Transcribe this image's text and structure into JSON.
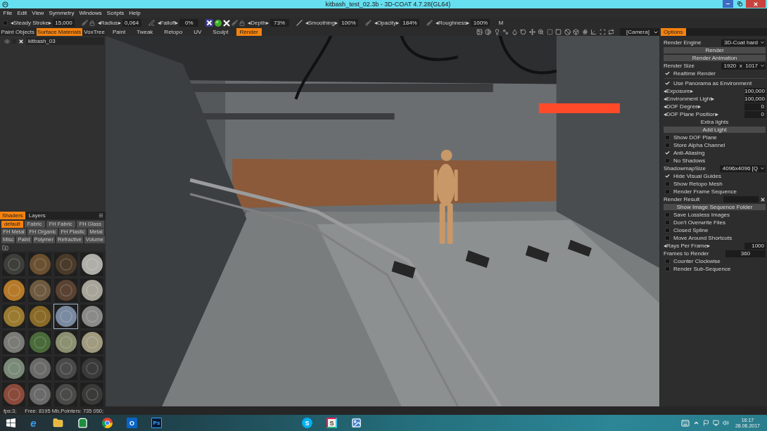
{
  "window": {
    "title": "kitbash_test_02.3b - 3D-COAT 4.7.28(GL64)"
  },
  "menu": [
    "File",
    "Edit",
    "View",
    "Symmetry",
    "Windows",
    "Scripts",
    "Help"
  ],
  "toolbar": {
    "steady_stroke": {
      "checked": false,
      "label": "◂Steady Stroke▸",
      "value": "15,000"
    },
    "params": [
      {
        "label": "◂Radius▸",
        "value": "0,064"
      },
      {
        "label": "◂Falloff▸",
        "value": "0%"
      },
      {
        "label": "◂Depth▸",
        "value": "73%"
      },
      {
        "label": "◂Smoothing▸",
        "value": "100%"
      },
      {
        "label": "◂Opacity▸",
        "value": "184%"
      },
      {
        "label": "◂Roughness▸",
        "value": "100%"
      }
    ],
    "end_label": "M"
  },
  "object_tabs": [
    {
      "label": "Paint Objects",
      "selected": false
    },
    {
      "label": "Surface Materials",
      "selected": true
    },
    {
      "label": "VoxTree",
      "selected": false
    }
  ],
  "room_tabs": [
    {
      "label": "Paint",
      "selected": false
    },
    {
      "label": "Tweak",
      "selected": false
    },
    {
      "label": "Retopo",
      "selected": false
    },
    {
      "label": "UV",
      "selected": false
    },
    {
      "label": "Sculpt",
      "selected": false
    },
    {
      "label": "Render",
      "selected": true
    }
  ],
  "camera": {
    "value": "[Camera]"
  },
  "options_tab": {
    "label": "Options",
    "selected": true
  },
  "scene_tree": [
    {
      "label": "kitbash_03"
    }
  ],
  "shader_tabs": [
    {
      "label": "Shaders",
      "selected": true
    },
    {
      "label": "Layers",
      "selected": false
    }
  ],
  "shader_categories": [
    [
      {
        "label": "default",
        "selected": true
      },
      {
        "label": "Fabric",
        "selected": false
      },
      {
        "label": "FH Fabric",
        "selected": false
      },
      {
        "label": "FH Glass",
        "selected": false
      }
    ],
    [
      {
        "label": "FH Metal",
        "selected": false
      },
      {
        "label": "FH Organic",
        "selected": false
      },
      {
        "label": "FH Plastic",
        "selected": false
      },
      {
        "label": "Metal",
        "selected": false
      }
    ],
    [
      {
        "label": "Misc",
        "selected": false
      },
      {
        "label": "Paint",
        "selected": false
      },
      {
        "label": "Polymer",
        "selected": false
      },
      {
        "label": "Refractive",
        "selected": false
      },
      {
        "label": "Volume",
        "selected": false
      }
    ]
  ],
  "materials": [
    {
      "color": "#3e3e3a",
      "selected": false
    },
    {
      "color": "#6a5030",
      "selected": false
    },
    {
      "color": "#4a3a2a",
      "selected": false
    },
    {
      "color": "#b0aea8",
      "selected": false
    },
    {
      "color": "#b47a2a",
      "selected": false
    },
    {
      "color": "#6e5a40",
      "selected": false
    },
    {
      "color": "#5a4232",
      "selected": false
    },
    {
      "color": "#a8a49a",
      "selected": false
    },
    {
      "color": "#9a7a30",
      "selected": false
    },
    {
      "color": "#8a6a28",
      "selected": false
    },
    {
      "color": "#7a8aa0",
      "selected": true
    },
    {
      "color": "#8a8a88",
      "selected": false
    },
    {
      "color": "#7a7a76",
      "selected": false
    },
    {
      "color": "#4a6a3a",
      "selected": false
    },
    {
      "color": "#8a9070",
      "selected": false
    },
    {
      "color": "#a09a80",
      "selected": false
    },
    {
      "color": "#7a8a78",
      "selected": false
    },
    {
      "color": "#6a6a68",
      "selected": false
    },
    {
      "color": "#4a4a4a",
      "selected": false
    },
    {
      "color": "#3a3a3a",
      "selected": false
    },
    {
      "color": "#8a4a3a",
      "selected": false
    },
    {
      "color": "#6a6a6a",
      "selected": false
    },
    {
      "color": "#4a4a48",
      "selected": false
    },
    {
      "color": "#3a3a38",
      "selected": false
    }
  ],
  "options": [
    {
      "kind": "dropdown",
      "label": "Render Engine",
      "value": "3D-Coat hard"
    },
    {
      "kind": "button",
      "label": "Render"
    },
    {
      "kind": "button",
      "label": "Render Animation"
    },
    {
      "kind": "dropdown",
      "label": "Render Size",
      "value": "1920  x  1017"
    },
    {
      "kind": "checkbox",
      "label": "Realtime Render",
      "checked": true
    },
    {
      "kind": "divider"
    },
    {
      "kind": "checkbox",
      "label": "Use Panorama as Environment",
      "checked": true
    },
    {
      "kind": "number",
      "label": "◂Exposure▸",
      "value": "100,000"
    },
    {
      "kind": "number",
      "label": "◂Environment Light▸",
      "value": "100,000"
    },
    {
      "kind": "number",
      "label": "◂DOF Degree▸",
      "value": "0"
    },
    {
      "kind": "number",
      "label": "◂DOF Plane Position▸",
      "value": "0"
    },
    {
      "kind": "heading",
      "label": "Extra lights"
    },
    {
      "kind": "button",
      "label": "Add Light"
    },
    {
      "kind": "checkbox",
      "label": "Show DOF Plane",
      "checked": false
    },
    {
      "kind": "checkbox",
      "label": "Store Alpha Channel",
      "checked": false
    },
    {
      "kind": "checkbox",
      "label": "Anti-Aliasing",
      "checked": true
    },
    {
      "kind": "checkbox",
      "label": "No Shadows",
      "checked": false
    },
    {
      "kind": "dropdown",
      "label": "ShadowmapSize",
      "value": "4096x4096 [Q"
    },
    {
      "kind": "checkbox",
      "label": "Hide Visual Guides",
      "checked": true
    },
    {
      "kind": "checkbox",
      "label": "Show Retopo Mesh",
      "checked": false
    },
    {
      "kind": "checkbox",
      "label": "Render Frame Sequence",
      "checked": false
    },
    {
      "kind": "field",
      "label": "Render Result"
    },
    {
      "kind": "button",
      "label": "Show Image Sequence Folder"
    },
    {
      "kind": "checkbox",
      "label": "Save Lossless Images",
      "checked": false
    },
    {
      "kind": "checkbox",
      "label": "Don't Overwrite Files",
      "checked": false
    },
    {
      "kind": "checkbox",
      "label": "Closed Spline",
      "checked": false
    },
    {
      "kind": "checkbox",
      "label": "Move Around Shortcuts",
      "checked": false
    },
    {
      "kind": "number",
      "label": "◂Rays Per Frame▸",
      "value": "1000"
    },
    {
      "kind": "wide_number",
      "label": "Frames to Render",
      "value": "360"
    },
    {
      "kind": "checkbox",
      "label": "Counter Clockwise",
      "checked": false
    },
    {
      "kind": "checkbox",
      "label": "Render Sub-Sequence",
      "checked": false
    }
  ],
  "status_bar": {
    "fps": "fps:3;",
    "memory": "Free: 8195 Mb,Pointers: 735 050;"
  },
  "taskbar": {
    "app_groups": [
      [
        {
          "kind": "letter",
          "glyph": "e"
        },
        {
          "kind": "folder"
        },
        {
          "kind": "bag"
        },
        {
          "kind": "wheel"
        },
        {
          "kind": "mail",
          "glyph": "O"
        },
        {
          "kind": "tile",
          "glyph": "Ps"
        }
      ],
      [
        {
          "kind": "bubble",
          "glyph": "S"
        },
        {
          "kind": "frame",
          "glyph": "S"
        },
        {
          "kind": "photo"
        }
      ]
    ],
    "time": "16:17",
    "date": "28.06.2017"
  }
}
